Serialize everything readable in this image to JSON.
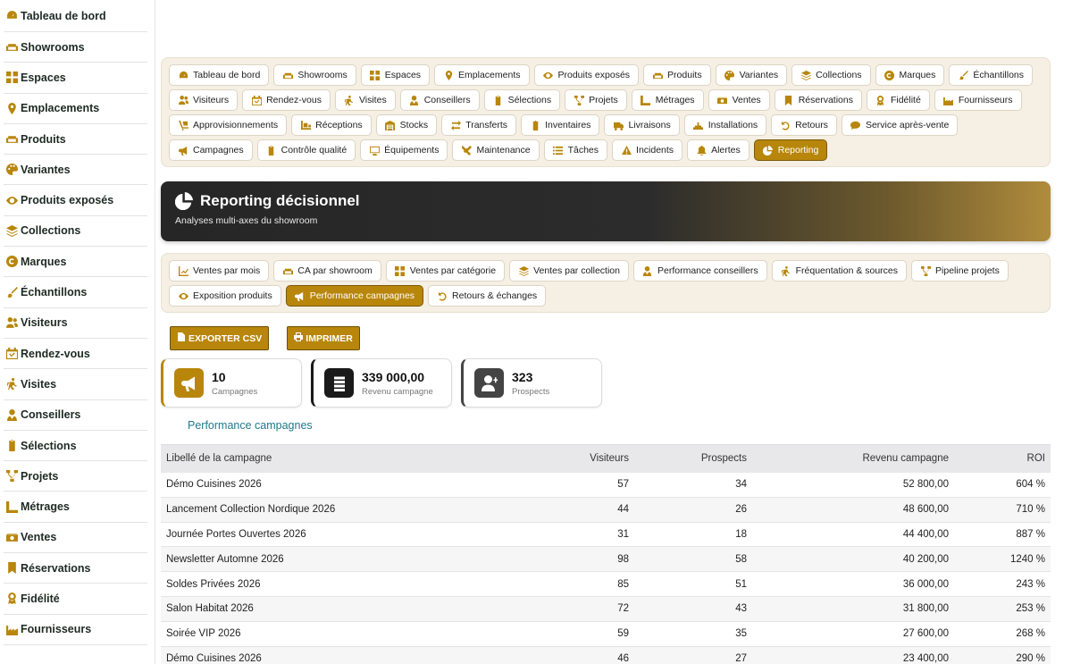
{
  "sidebar": {
    "items": [
      {
        "label": "Tableau de bord",
        "icon": "gauge-icon"
      },
      {
        "label": "Showrooms",
        "icon": "couch-icon"
      },
      {
        "label": "Espaces",
        "icon": "grid-icon"
      },
      {
        "label": "Emplacements",
        "icon": "map-pin-icon"
      },
      {
        "label": "Produits",
        "icon": "couch-icon"
      },
      {
        "label": "Variantes",
        "icon": "palette-icon"
      },
      {
        "label": "Produits exposés",
        "icon": "eye-icon"
      },
      {
        "label": "Collections",
        "icon": "layers-icon"
      },
      {
        "label": "Marques",
        "icon": "copyright-icon"
      },
      {
        "label": "Échantillons",
        "icon": "brush-icon"
      },
      {
        "label": "Visiteurs",
        "icon": "users-icon"
      },
      {
        "label": "Rendez-vous",
        "icon": "calendar-icon"
      },
      {
        "label": "Visites",
        "icon": "walking-icon"
      },
      {
        "label": "Conseillers",
        "icon": "user-tie-icon"
      },
      {
        "label": "Sélections",
        "icon": "clipboard-icon"
      },
      {
        "label": "Projets",
        "icon": "project-diagram-icon"
      },
      {
        "label": "Métrages",
        "icon": "ruler-icon"
      },
      {
        "label": "Ventes",
        "icon": "cash-icon"
      },
      {
        "label": "Réservations",
        "icon": "bookmark-icon"
      },
      {
        "label": "Fidélité",
        "icon": "award-icon"
      },
      {
        "label": "Fournisseurs",
        "icon": "industry-icon"
      }
    ]
  },
  "top_tabs": [
    {
      "label": "Tableau de bord",
      "icon": "gauge-icon"
    },
    {
      "label": "Showrooms",
      "icon": "couch-icon"
    },
    {
      "label": "Espaces",
      "icon": "grid-icon"
    },
    {
      "label": "Emplacements",
      "icon": "map-pin-icon"
    },
    {
      "label": "Produits exposés",
      "icon": "eye-icon"
    },
    {
      "label": "Produits",
      "icon": "couch-icon"
    },
    {
      "label": "Variantes",
      "icon": "palette-icon"
    },
    {
      "label": "Collections",
      "icon": "layers-icon"
    },
    {
      "label": "Marques",
      "icon": "copyright-icon"
    },
    {
      "label": "Échantillons",
      "icon": "brush-icon"
    },
    {
      "label": "Visiteurs",
      "icon": "users-icon"
    },
    {
      "label": "Rendez-vous",
      "icon": "calendar-icon"
    },
    {
      "label": "Visites",
      "icon": "walking-icon"
    },
    {
      "label": "Conseillers",
      "icon": "user-tie-icon"
    },
    {
      "label": "Sélections",
      "icon": "clipboard-icon"
    },
    {
      "label": "Projets",
      "icon": "project-diagram-icon"
    },
    {
      "label": "Métrages",
      "icon": "ruler-icon"
    },
    {
      "label": "Ventes",
      "icon": "cash-icon"
    },
    {
      "label": "Réservations",
      "icon": "bookmark-icon"
    },
    {
      "label": "Fidélité",
      "icon": "award-icon"
    },
    {
      "label": "Fournisseurs",
      "icon": "industry-icon"
    },
    {
      "label": "Approvisionnements",
      "icon": "dolly-icon"
    },
    {
      "label": "Réceptions",
      "icon": "truck-loading-icon"
    },
    {
      "label": "Stocks",
      "icon": "warehouse-icon"
    },
    {
      "label": "Transferts",
      "icon": "exchange-icon"
    },
    {
      "label": "Inventaires",
      "icon": "clipboard-check-icon"
    },
    {
      "label": "Livraisons",
      "icon": "truck-icon"
    },
    {
      "label": "Installations",
      "icon": "tools-icon"
    },
    {
      "label": "Retours",
      "icon": "undo-icon"
    },
    {
      "label": "Service après-vente",
      "icon": "comment-icon"
    },
    {
      "label": "Campagnes",
      "icon": "bullhorn-icon"
    },
    {
      "label": "Contrôle qualité",
      "icon": "clipboard-icon"
    },
    {
      "label": "Équipements",
      "icon": "desktop-icon"
    },
    {
      "label": "Maintenance",
      "icon": "wrench-icon"
    },
    {
      "label": "Tâches",
      "icon": "list-icon"
    },
    {
      "label": "Incidents",
      "icon": "warning-icon"
    },
    {
      "label": "Alertes",
      "icon": "bell-icon"
    },
    {
      "label": "Reporting",
      "icon": "pie-chart-icon",
      "active": true
    }
  ],
  "hero": {
    "title": "Reporting décisionnel",
    "subtitle": "Analyses multi-axes du showroom",
    "icon": "pie-chart-icon"
  },
  "report_tabs": [
    {
      "label": "Ventes par mois",
      "icon": "chart-line-icon"
    },
    {
      "label": "CA par showroom",
      "icon": "couch-icon"
    },
    {
      "label": "Ventes par catégorie",
      "icon": "grid-icon"
    },
    {
      "label": "Ventes par collection",
      "icon": "layers-icon"
    },
    {
      "label": "Performance conseillers",
      "icon": "user-tie-icon"
    },
    {
      "label": "Fréquentation & sources",
      "icon": "walking-icon"
    },
    {
      "label": "Pipeline projets",
      "icon": "project-diagram-icon"
    },
    {
      "label": "Exposition produits",
      "icon": "eye-icon"
    },
    {
      "label": "Performance campagnes",
      "icon": "bullhorn-icon",
      "active": true
    },
    {
      "label": "Retours & échanges",
      "icon": "undo-icon"
    }
  ],
  "actions": {
    "export_label": "EXPORTER CSV",
    "print_label": "IMPRIMER"
  },
  "kpis": [
    {
      "value": "10",
      "label": "Campagnes",
      "icon": "bullhorn-icon",
      "color": "#b8860b"
    },
    {
      "value": "339 000,00",
      "label": "Revenu campagne",
      "icon": "coins-icon",
      "color": "#1a1a1a"
    },
    {
      "value": "323",
      "label": "Prospects",
      "icon": "user-plus-icon",
      "color": "#444444"
    }
  ],
  "section_title": "Performance campagnes",
  "table": {
    "headers": [
      "Libellé de la campagne",
      "Visiteurs",
      "Prospects",
      "Revenu campagne",
      "ROI"
    ],
    "rows": [
      [
        "Démo Cuisines 2026",
        "57",
        "34",
        "52 800,00",
        "604 %"
      ],
      [
        "Lancement Collection Nordique 2026",
        "44",
        "26",
        "48 600,00",
        "710 %"
      ],
      [
        "Journée Portes Ouvertes 2026",
        "31",
        "18",
        "44 400,00",
        "887 %"
      ],
      [
        "Newsletter Automne 2026",
        "98",
        "58",
        "40 200,00",
        "1240 %"
      ],
      [
        "Soldes Privées 2026",
        "85",
        "51",
        "36 000,00",
        "243 %"
      ],
      [
        "Salon Habitat 2026",
        "72",
        "43",
        "31 800,00",
        "253 %"
      ],
      [
        "Soirée VIP 2026",
        "59",
        "35",
        "27 600,00",
        "268 %"
      ],
      [
        "Démo Cuisines 2026",
        "46",
        "27",
        "23 400,00",
        "290 %"
      ]
    ]
  },
  "colors": {
    "accent": "#b8860b",
    "link": "#1f7a8c"
  }
}
